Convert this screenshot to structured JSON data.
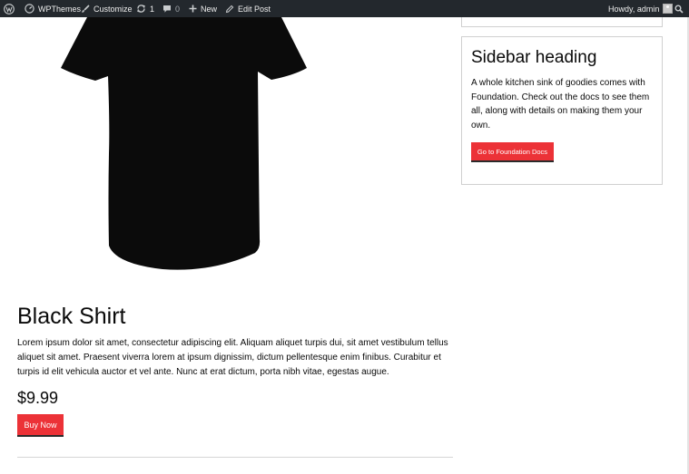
{
  "adminbar": {
    "site_name": "WPThemes",
    "customize": "Customize",
    "updates_count": "1",
    "comments_count": "0",
    "new_label": "New",
    "edit_label": "Edit Post",
    "howdy": "Howdy, admin"
  },
  "product": {
    "title": "Black Shirt",
    "description": "Lorem ipsum dolor sit amet, consectetur adipiscing elit. Aliquam aliquet turpis dui, sit amet vestibulum tellus aliquet sit amet. Praesent viverra lorem at ipsum dignissim, dictum pellentesque enim finibus. Curabitur et turpis id elit vehicula auctor et vel ante. Nunc at erat dictum, porta nibh vitae, egestas augue.",
    "price": "$9.99",
    "buy_label": "Buy Now"
  },
  "sidebar": {
    "heading": "Sidebar heading",
    "text": "A whole kitchen sink of goodies comes with Foundation. Check out the docs to see them all, along with details on making them your own.",
    "button_label": "Go to Foundation Docs"
  },
  "colors": {
    "adminbar_bg": "#23282d",
    "button_red": "#ec3237",
    "shirt": "#0b0b0b"
  },
  "icons": [
    "wordpress-icon",
    "site-icon",
    "brush-icon",
    "updates-icon",
    "comment-icon",
    "plus-icon",
    "pencil-icon",
    "avatar",
    "search-icon"
  ]
}
